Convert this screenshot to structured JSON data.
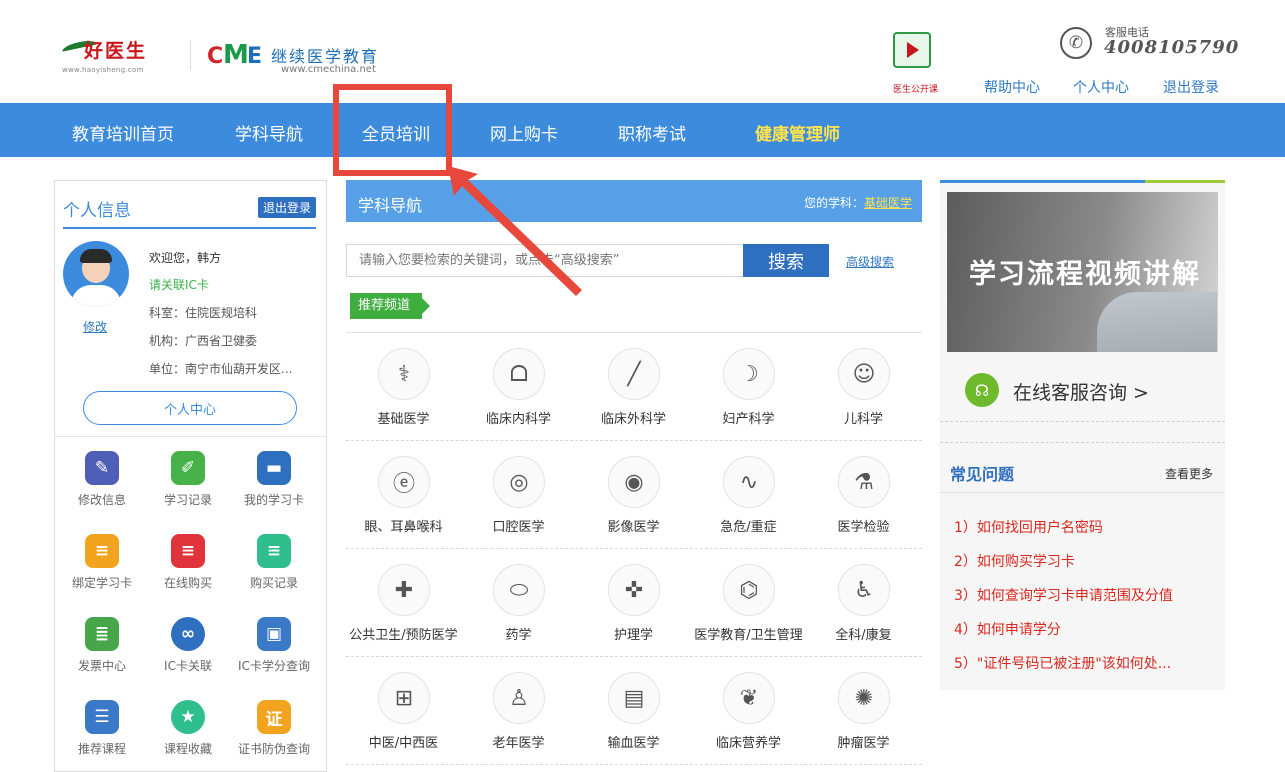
{
  "header": {
    "logo_haoyisheng": "好医生",
    "logo_haoyisheng_url": "www.haoyisheng.com",
    "logo_cme_letters": [
      "C",
      "M",
      "E"
    ],
    "logo_cme_name": "继续医学教育",
    "logo_cme_url": "www.cmechina.net",
    "public_class_label": "医生公开课",
    "phone_label": "客服电话",
    "phone_number": "4008105790",
    "links": [
      "帮助中心",
      "个人中心",
      "退出登录"
    ]
  },
  "nav": {
    "items": [
      "教育培训首页",
      "学科导航",
      "全员培训",
      "网上购卡",
      "职称考试",
      "健康管理师"
    ],
    "highlight_index": 5,
    "annotated_index": 2
  },
  "profile": {
    "title": "个人信息",
    "logout": "退出登录",
    "welcome": "欢迎您，韩方",
    "ic_link": "请关联IC卡",
    "dept": "科室：住院医规培科",
    "org": "机构：广西省卫健委",
    "unit": "单位：南宁市仙葫开发区...",
    "edit": "修改",
    "center_button": "个人中心"
  },
  "quick_links": [
    {
      "label": "修改信息",
      "icon": "edit-icon",
      "color": "#4f5fb8",
      "glyph": "✎"
    },
    {
      "label": "学习记录",
      "icon": "notebook-icon",
      "color": "#47b24a",
      "glyph": "✐"
    },
    {
      "label": "我的学习卡",
      "icon": "card-icon",
      "color": "#2f6fc0",
      "glyph": "▬"
    },
    {
      "label": "绑定学习卡",
      "icon": "bind-card-icon",
      "color": "#f2a41f",
      "glyph": "≡"
    },
    {
      "label": "在线购买",
      "icon": "cart-icon",
      "color": "#e0333c",
      "glyph": "≡"
    },
    {
      "label": "购买记录",
      "icon": "record-icon",
      "color": "#2fbf8c",
      "glyph": "≡"
    },
    {
      "label": "发票中心",
      "icon": "invoice-icon",
      "color": "#47a64a",
      "glyph": "≣"
    },
    {
      "label": "IC卡关联",
      "icon": "link-icon",
      "color": "#2f6fc0",
      "glyph": "∞"
    },
    {
      "label": "IC卡学分查询",
      "icon": "query-icon",
      "color": "#3a78c8",
      "glyph": "▣"
    },
    {
      "label": "推荐课程",
      "icon": "books-icon",
      "color": "#3a78c8",
      "glyph": "☰"
    },
    {
      "label": "课程收藏",
      "icon": "star-icon",
      "color": "#2fbf8c",
      "glyph": "★"
    },
    {
      "label": "证书防伪查询",
      "icon": "certificate-icon",
      "color": "#f2a41f",
      "glyph": "证"
    }
  ],
  "subject_panel": {
    "title": "学科导航",
    "my_subject_label": "您的学科：",
    "my_subject_value": "基础医学",
    "search_placeholder": "请输入您要检索的关键词，或点击“高级搜索”",
    "search_button": "搜索",
    "advanced_search": "高级搜索",
    "recommend_tag": "推荐频道",
    "subjects": [
      {
        "label": "基础医学",
        "icon": "stethoscope-icon",
        "glyph": "⚕"
      },
      {
        "label": "临床内科学",
        "icon": "lungs-icon",
        "glyph": "ᗝ"
      },
      {
        "label": "临床外科学",
        "icon": "scalpel-icon",
        "glyph": "╱"
      },
      {
        "label": "妇产科学",
        "icon": "fetus-icon",
        "glyph": "☽"
      },
      {
        "label": "儿科学",
        "icon": "baby-face-icon",
        "glyph": "☺"
      },
      {
        "label": "眼、耳鼻喉科",
        "icon": "ear-icon",
        "glyph": "ⓔ"
      },
      {
        "label": "口腔医学",
        "icon": "mouth-icon",
        "glyph": "◎"
      },
      {
        "label": "影像医学",
        "icon": "scanner-icon",
        "glyph": "◉"
      },
      {
        "label": "急危/重症",
        "icon": "ecg-monitor-icon",
        "glyph": "∿"
      },
      {
        "label": "医学检验",
        "icon": "lab-flask-icon",
        "glyph": "⚗"
      },
      {
        "label": "公共卫生/预防医学",
        "icon": "shield-plus-icon",
        "glyph": "✚"
      },
      {
        "label": "药学",
        "icon": "pill-icon",
        "glyph": "⬭"
      },
      {
        "label": "护理学",
        "icon": "cross-leaf-icon",
        "glyph": "✜"
      },
      {
        "label": "医学教育/卫生管理",
        "icon": "microscope-icon",
        "glyph": "⌬"
      },
      {
        "label": "全科/康复",
        "icon": "elderly-icon",
        "glyph": "♿"
      },
      {
        "label": "中医/中西医",
        "icon": "medical-kit-icon",
        "glyph": "⊞"
      },
      {
        "label": "老年医学",
        "icon": "person-cane-icon",
        "glyph": "♙"
      },
      {
        "label": "输血医学",
        "icon": "blood-bag-icon",
        "glyph": "▤"
      },
      {
        "label": "临床营养学",
        "icon": "apple-icon",
        "glyph": "❦"
      },
      {
        "label": "肿瘤医学",
        "icon": "cell-icon",
        "glyph": "✺"
      }
    ]
  },
  "right_panel": {
    "video_title": "学习流程视频讲解",
    "online_service": "在线客服咨询 >",
    "faq_title": "常见问题",
    "faq_more": "查看更多",
    "faq_items": [
      "1）如何找回用户名密码",
      "2）如何购买学习卡",
      "3）如何查询学习卡申请范围及分值",
      "4）如何申请学分",
      "5）\"证件号码已被注册\"该如何处..."
    ]
  }
}
